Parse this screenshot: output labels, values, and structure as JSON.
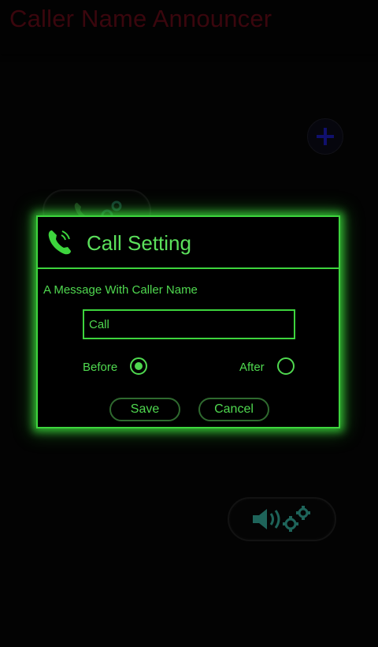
{
  "app": {
    "title": "Caller Name Announcer"
  },
  "icons": {
    "add": "plus-icon",
    "call_settings": "phone-gear-icon",
    "speaker_settings": "speaker-gear-icon",
    "dialog_phone": "phone-ringing-icon"
  },
  "colors": {
    "accent_green": "#3dd43d",
    "title_red": "#5a0a14",
    "add_blue": "#1a1aa8",
    "speaker_teal": "#2f9a8a"
  },
  "dialog": {
    "title": "Call Setting",
    "message_label": "A Message With Caller Name",
    "input_value": "Call",
    "options": {
      "before_label": "Before",
      "after_label": "After",
      "selected": "Before"
    },
    "save_label": "Save",
    "cancel_label": "Cancel"
  }
}
